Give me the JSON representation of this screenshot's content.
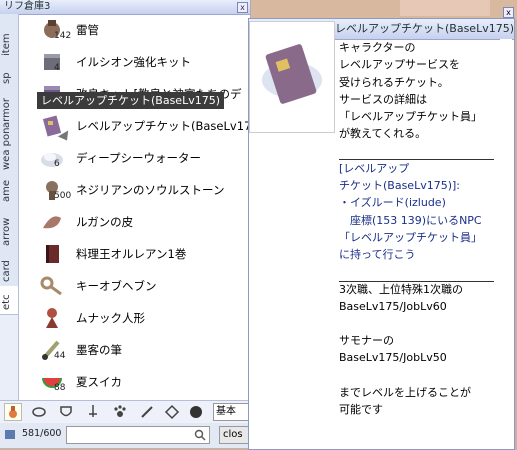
{
  "storage": {
    "title": "リフ倉庫3",
    "close": "x",
    "tabs": [
      "item",
      "sp",
      "armor",
      "wea pon",
      "ame",
      "arrow",
      "card",
      "etc"
    ],
    "items": [
      {
        "name": "雷管",
        "qty": "142",
        "icon": "detonator-icon",
        "color": "#8c6d5a"
      },
      {
        "name": "イルシオン強化キット",
        "qty": "4",
        "icon": "kit-box-icon",
        "color": "#6d6d78"
      },
      {
        "name": "改良キット[教皇と神官たちのデ",
        "qty": "",
        "icon": "kit-box-icon",
        "color": "#6e5a8a"
      },
      {
        "name": "レベルアップチケット(BaseLv175)",
        "qty": "",
        "icon": "ticket-icon",
        "color": "#8a6a9a"
      },
      {
        "name": "ディープシーウォーター",
        "qty": "6",
        "icon": "water-icon",
        "color": "#d8dde8"
      },
      {
        "name": "ネジリアンのソウルストーン",
        "qty": "500",
        "icon": "soulstone-icon",
        "color": "#8a7060"
      },
      {
        "name": "ルガンの皮",
        "qty": "",
        "icon": "skin-icon",
        "color": "#a87868"
      },
      {
        "name": "料理王オルレアン1巻",
        "qty": "",
        "icon": "book-icon",
        "color": "#6a2a2a"
      },
      {
        "name": "キーオブヘブン",
        "qty": "",
        "icon": "key-icon",
        "color": "#a88a6a"
      },
      {
        "name": "ムナック人形",
        "qty": "",
        "icon": "doll-icon",
        "color": "#b05040"
      },
      {
        "name": "墨客の筆",
        "qty": "44",
        "icon": "brush-icon",
        "color": "#a0a070"
      },
      {
        "name": "夏スイカ",
        "qty": "88",
        "icon": "watermelon-icon",
        "color": "#3a9a3a"
      }
    ],
    "tooltip": "レベルアップチケット(BaseLv175)",
    "filter": "基本",
    "count": "581/600",
    "close_label": "clos"
  },
  "description": {
    "title": "レベルアップチケット(BaseLv175)",
    "lines1": [
      "キャラクターの",
      "レベルアップサービスを",
      "受けられるチケット。",
      "サービスの詳細は",
      "「レベルアップチケット員」",
      "が教えてくれる。"
    ],
    "lines2": [
      "[レベルアップ",
      "チケット(BaseLv175)]:",
      "・イズルード(izlude)",
      "　座標(153 139)にいるNPC",
      "「レベルアップチケット員」",
      "に持って行こう"
    ],
    "lines3": [
      "3次職、上位特殊1次職の",
      "BaseLv175/JobLv60"
    ],
    "lines4": [
      "サモナーの",
      "BaseLv175/JobLv50"
    ],
    "lines5": [
      "までレベルを上げることが",
      "可能です"
    ]
  },
  "colors": {
    "accent": "#c6d1ef",
    "link": "#1a2f8a"
  }
}
